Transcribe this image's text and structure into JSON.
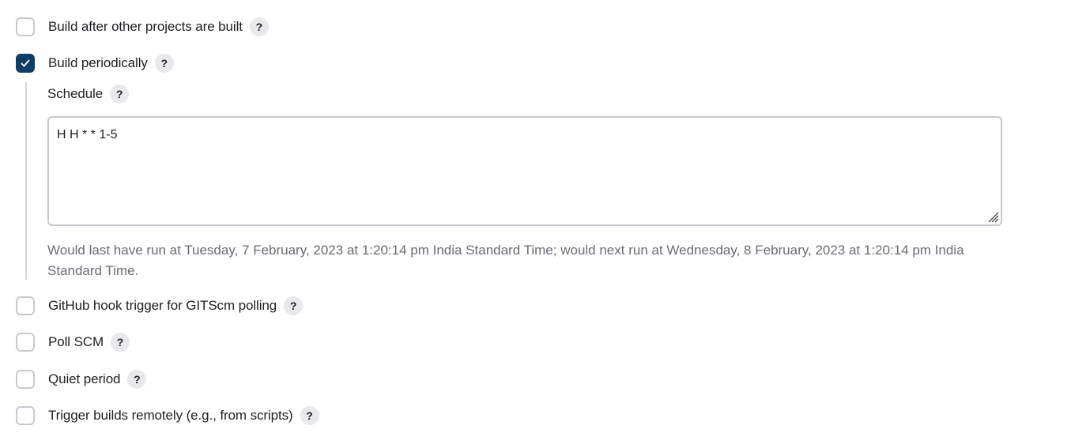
{
  "triggers": {
    "build_after_other": {
      "label": "Build after other projects are built",
      "checked": false,
      "help": "?"
    },
    "build_periodically": {
      "label": "Build periodically",
      "checked": true,
      "help": "?"
    },
    "github_hook": {
      "label": "GitHub hook trigger for GITScm polling",
      "checked": false,
      "help": "?"
    },
    "poll_scm": {
      "label": "Poll SCM",
      "checked": false,
      "help": "?"
    },
    "quiet_period": {
      "label": "Quiet period",
      "checked": false,
      "help": "?"
    },
    "trigger_remotely": {
      "label": "Trigger builds remotely (e.g., from scripts)",
      "checked": false,
      "help": "?"
    }
  },
  "schedule": {
    "label": "Schedule",
    "help": "?",
    "value": "H H * * 1-5",
    "info": "Would last have run at Tuesday, 7 February, 2023 at 1:20:14 pm India Standard Time; would next run at Wednesday, 8 February, 2023 at 1:20:14 pm India Standard Time."
  },
  "colors": {
    "checked_bg": "#0f3d66",
    "checkbox_border": "#c8c8cf",
    "help_bg": "#e9e9ec",
    "info_text": "#6b6b75"
  },
  "icons": {
    "checkmark": "check-icon",
    "help": "help-icon",
    "resize": "resize-grip-icon"
  }
}
